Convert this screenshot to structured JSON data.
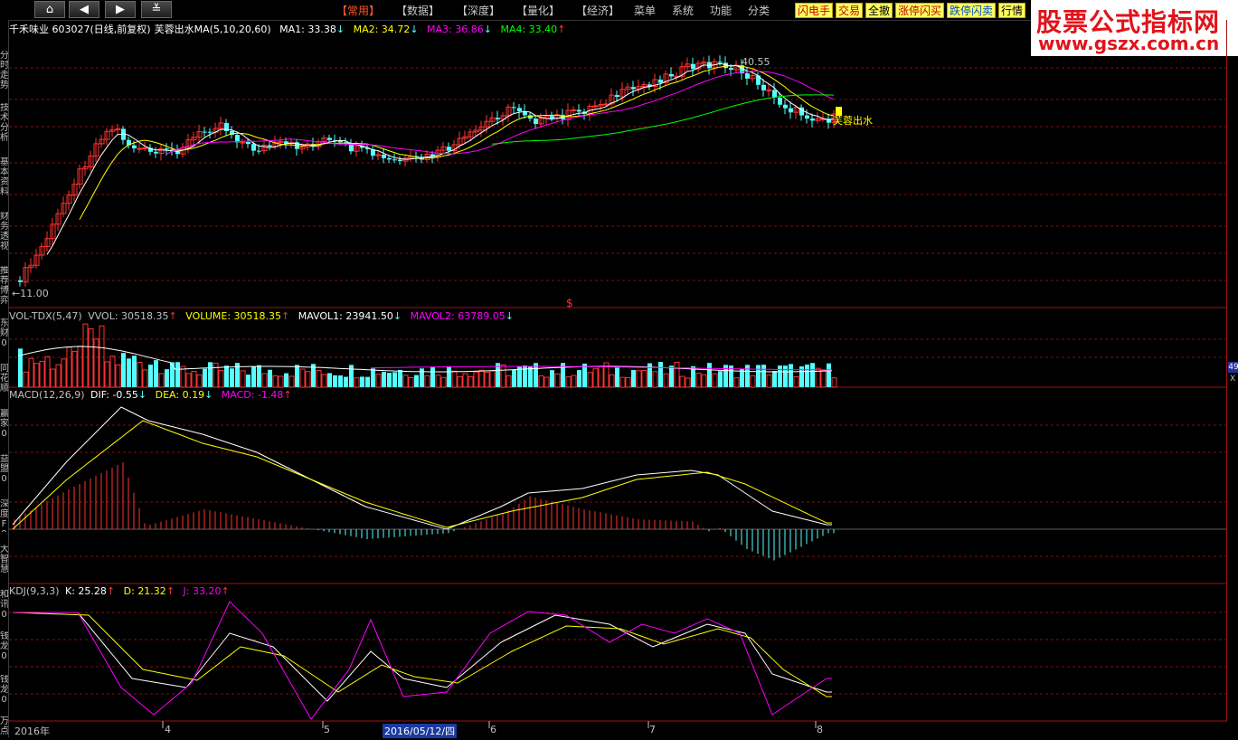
{
  "toolbar": {
    "nav": [
      {
        "name": "home-button",
        "glyph": "⌂"
      },
      {
        "name": "back-button",
        "glyph": "◀"
      },
      {
        "name": "forward-button",
        "glyph": "▶"
      },
      {
        "name": "collapse-button",
        "glyph": "≚"
      }
    ],
    "menus": [
      "【常用】",
      "【数据】",
      "【深度】",
      "【量化】",
      "【经济】",
      "菜单",
      "系统",
      "功能",
      "分类"
    ],
    "quick": [
      "闪电手",
      "交易",
      "全撤",
      "涨停闪买",
      "跌停闪卖",
      "行情"
    ]
  },
  "watermark": {
    "line1": "股票公式指标网",
    "line2": "www.gszx.com.cn"
  },
  "sidebar": {
    "tabs": [
      "分时走势",
      "技术分析",
      "基本资料",
      "财务透视",
      "推荐博弈",
      "东财0",
      "同花顺",
      "赢家0",
      "益盟0",
      "深度F9",
      "大智慧",
      "和讯0",
      "钱龙0",
      "钱龙0",
      "万点"
    ]
  },
  "price_pane": {
    "stock": "千禾味业 603027(日线,前复权)",
    "indicator": "芙蓉出水MA(5,10,20,60)",
    "ma": [
      {
        "label": "MA1: 33.38",
        "arrow": "↓",
        "color": "#ffffff"
      },
      {
        "label": "MA2: 34.72",
        "arrow": "↓",
        "color": "#ffff00"
      },
      {
        "label": "MA3: 36.86",
        "arrow": "↓",
        "color": "#ff00ff"
      },
      {
        "label": "MA4: 33.40",
        "arrow": "↑",
        "color": "#00ff00"
      }
    ],
    "high_label": "40.55",
    "low_label": "11.00",
    "signal_label": "芙蓉出水",
    "marker": "$"
  },
  "vol_pane": {
    "name": "VOL-TDX(5,47)",
    "items": [
      {
        "label": "VVOL: 30518.35",
        "arrow": "↑",
        "color": "#c0c0c0"
      },
      {
        "label": "VOLUME: 30518.35",
        "arrow": "↑",
        "color": "#ffff00"
      },
      {
        "label": "MAVOL1: 23941.50",
        "arrow": "↓",
        "color": "#ffffff"
      },
      {
        "label": "MAVOL2: 63789.05",
        "arrow": "↓",
        "color": "#ff00ff"
      }
    ],
    "axis_badge": "49",
    "axis_x": "X"
  },
  "macd_pane": {
    "name": "MACD(12,26,9)",
    "items": [
      {
        "label": "DIF: -0.55",
        "arrow": "↓",
        "color": "#ffffff"
      },
      {
        "label": "DEA: 0.19",
        "arrow": "↓",
        "color": "#ffff00"
      },
      {
        "label": "MACD: -1.48",
        "arrow": "↑",
        "color": "#ff00ff"
      }
    ]
  },
  "kdj_pane": {
    "name": "KDJ(9,3,3)",
    "items": [
      {
        "label": "K: 25.28",
        "arrow": "↑",
        "color": "#ffffff"
      },
      {
        "label": "D: 21.32",
        "arrow": "↑",
        "color": "#ffff00"
      },
      {
        "label": "J: 33.20",
        "arrow": "↑",
        "color": "#ff00ff"
      }
    ]
  },
  "date_axis": {
    "labels": [
      "2016年",
      "4",
      "5",
      "2016/05/12/四",
      "6",
      "7",
      "8"
    ]
  },
  "colors": {
    "up": "#ff3232",
    "down": "#54ffff",
    "grid": "#a01010",
    "signal": "#ffff00"
  },
  "chart_data": {
    "type": "candlestick",
    "candles": [],
    "k": [],
    "d": [],
    "j": [],
    "volume": [],
    "macd_hist": []
  }
}
